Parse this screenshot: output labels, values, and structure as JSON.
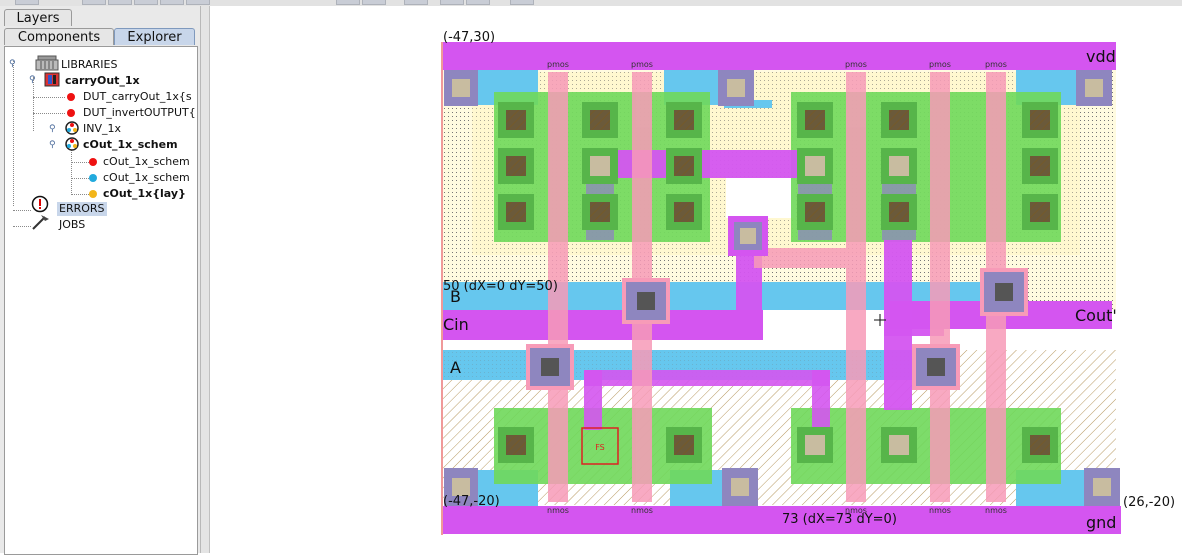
{
  "window": {
    "toolbar_buttons": 12
  },
  "panel": {
    "tabs": {
      "layers": "Layers",
      "components": "Components",
      "explorer": "Explorer"
    },
    "tree": {
      "libraries": "LIBRARIES",
      "carryout_lib": "carryOut_1x",
      "dut_carryout": "DUT_carryOut_1x{s",
      "dut_invert": "DUT_invertOUTPUT{",
      "inv": "INV_1x",
      "cout_group": "cOut_1x_schem",
      "cout_schem_1": "cOut_1x_schem",
      "cout_schem_2": "cOut_1x_schem",
      "cout_lay": "cOut_1x{lay}",
      "errors": "ERRORS",
      "jobs": "JOBS"
    },
    "colors": {
      "red_dot": "#ee1111",
      "blue_dot": "#22aadd",
      "orange_dot": "#f2b51a",
      "selected_bg": "#c8d6ea"
    }
  },
  "layout": {
    "corner_top_left": "(-47,30)",
    "corner_bottom_left": "(-47,-20)",
    "corner_bottom_right": "(26,-20)",
    "measure_vertical": "50 (dX=0 dY=50)",
    "measure_horizontal": "73 (dX=73 dY=0)",
    "net_vdd": "vdd",
    "net_gnd": "gnd",
    "net_b": "B",
    "net_cin": "Cin",
    "net_a": "A",
    "net_cout": "Cout'",
    "pmos_label": "pmos",
    "nmos_label": "nmos",
    "fs_label": "FS",
    "colors": {
      "metal1": "#66c7ee",
      "metal2": "#d455f0",
      "poly": "#f79bb8",
      "active": "#6fd85a",
      "contact": "#8e86bf",
      "nwell": "#fff6c4",
      "bound_red": "#e03333"
    }
  }
}
